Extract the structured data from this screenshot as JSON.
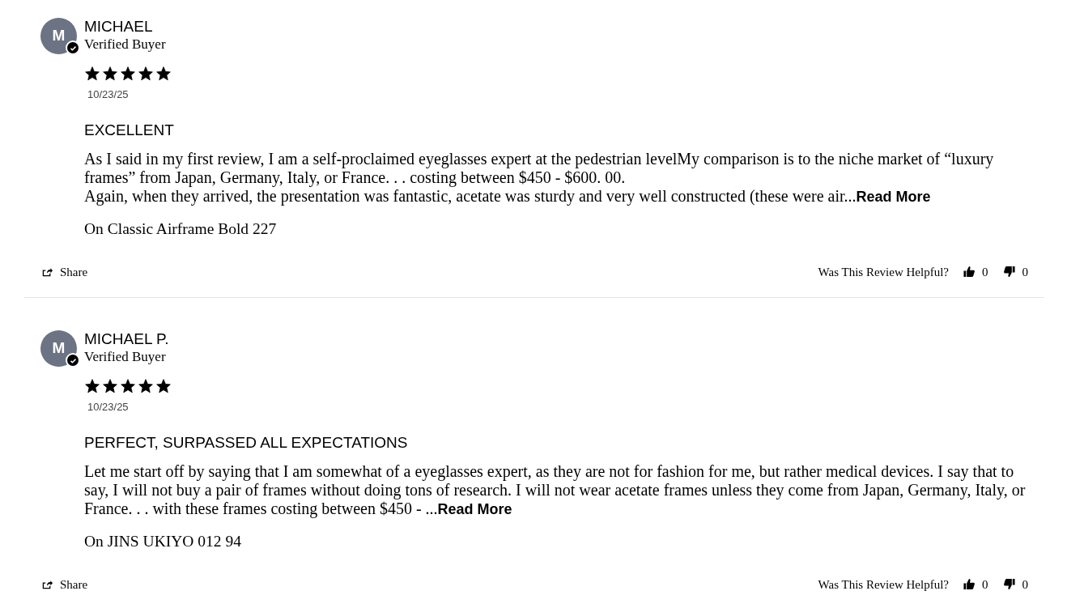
{
  "reviews": [
    {
      "initial": "M",
      "name": "MICHAEL",
      "badge": "Verified Buyer",
      "stars": 5,
      "date": "10/23/25",
      "title": "EXCELLENT",
      "body": [
        "As I said in my first review, I am a self-proclaimed eyeglasses expert at the pedestrian levelMy comparison is to the niche market of “luxury frames” from Japan, Germany, Italy, or France. . . costing between $450 - $600. 00.",
        "Again, when they arrived, the presentation was fantastic, acetate was sturdy and very well constructed (these were air..."
      ],
      "read_more": "Read More",
      "product": "On Classic Airframe Bold 227",
      "share": "Share",
      "helpful_label": "Was This Review Helpful?",
      "up_count": "0",
      "down_count": "0"
    },
    {
      "initial": "M",
      "name": "MICHAEL P.",
      "badge": "Verified Buyer",
      "stars": 5,
      "date": "10/23/25",
      "title": "PERFECT, SURPASSED ALL EXPECTATIONS",
      "body": [
        "Let me start off by saying that I am somewhat of a eyeglasses expert, as they are not for fashion for me, but rather medical devices. I say that to say, I will not buy a pair of frames without doing tons of research. I will not wear acetate frames unless they come from Japan, Germany, Italy, or France. . . with these frames costing between $450 - ..."
      ],
      "read_more": "Read More",
      "product": "On JINS UKIYO 012 94",
      "share": "Share",
      "helpful_label": "Was This Review Helpful?",
      "up_count": "0",
      "down_count": "0"
    }
  ]
}
